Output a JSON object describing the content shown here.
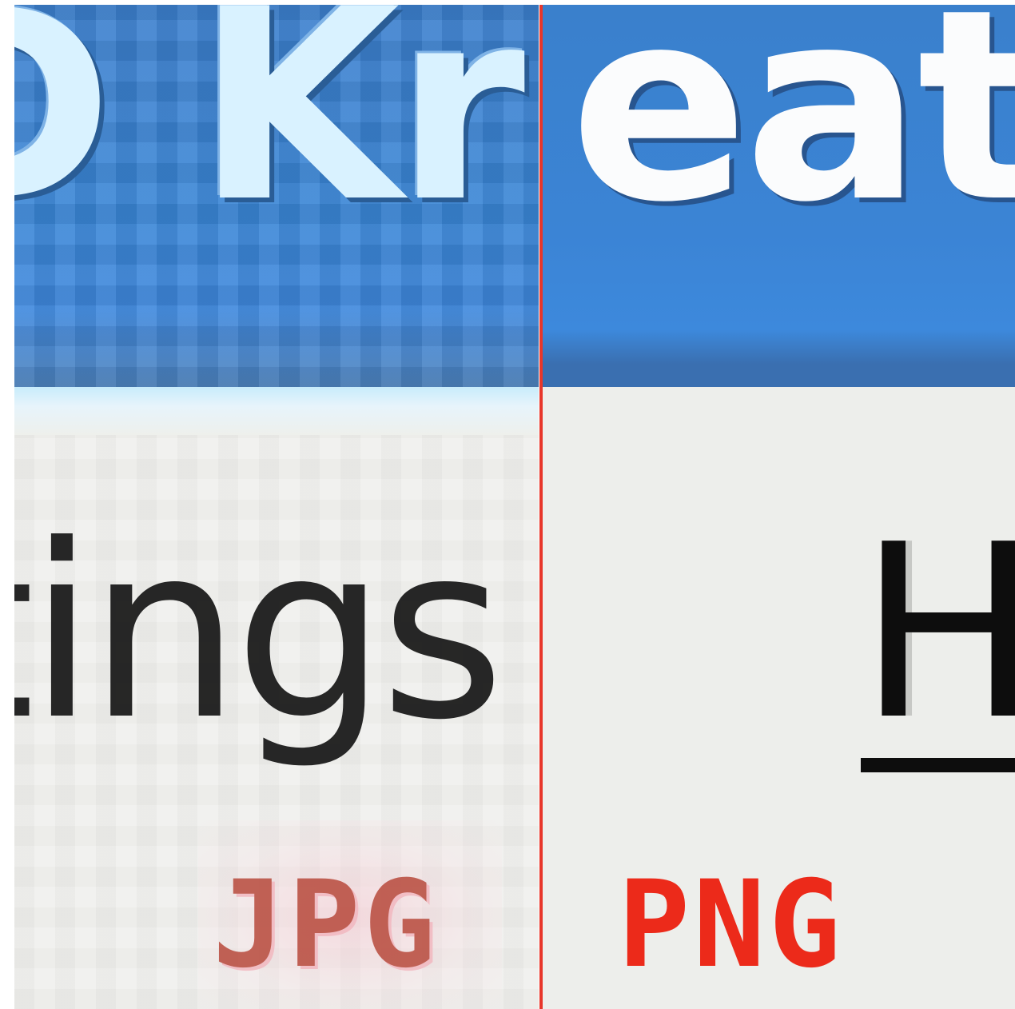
{
  "comparison": {
    "left": {
      "format_label": "JPG",
      "title_fragment": "D Kr",
      "body_fragment": "tings"
    },
    "right": {
      "format_label": "PNG",
      "title_fragment": "eat",
      "body_fragment": "H"
    }
  },
  "colors": {
    "titlebar_blue": "#3b84d5",
    "divider_red": "#e8362a",
    "png_label_red": "#ec2a1a",
    "jpg_label_red": "#b84a3c",
    "panel_background": "#edeeeb"
  }
}
